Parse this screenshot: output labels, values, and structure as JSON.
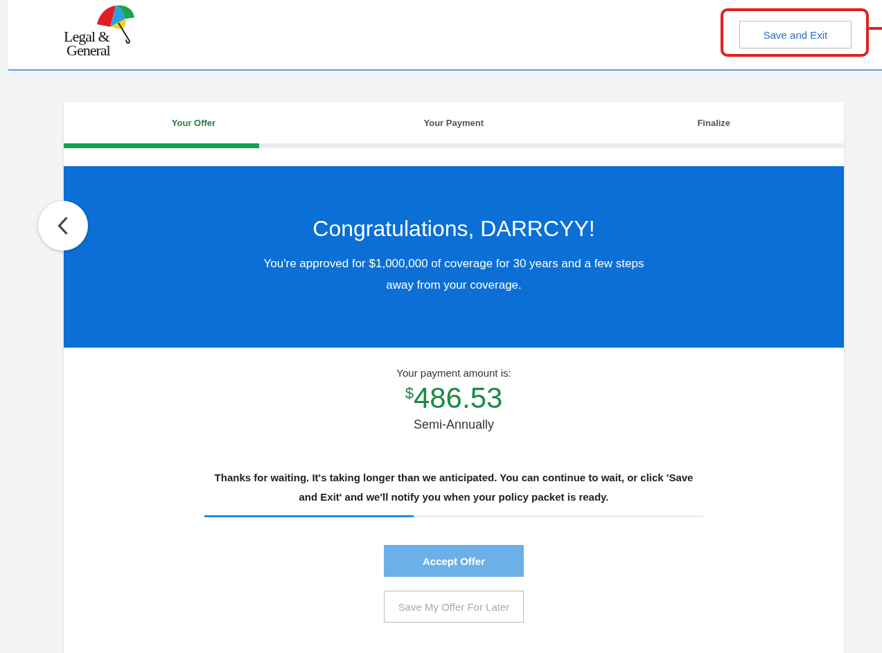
{
  "header": {
    "logo": {
      "line_1": "Legal &",
      "line_2": "General"
    },
    "save_button": {
      "label": "Save and Exit",
      "highlighted": true
    }
  },
  "steps": [
    {
      "label": "Your Offer",
      "selected": true
    },
    {
      "label": "Your Payment",
      "selected": false
    },
    {
      "label": "Finalize",
      "selected": false
    }
  ],
  "step_progress": {
    "level": 0.25
  },
  "banner": {
    "title": "Congratulations, DARRCYY!",
    "message": "You're approved for $1,000,000 of coverage for 30 years and a few steps away from your coverage."
  },
  "payment": {
    "label": "Your payment amount is:",
    "currency": "$",
    "amount": "486.53",
    "frequency": "Semi-Annually"
  },
  "notice": "Thanks for waiting. It's taking longer than we anticipated. You can continue to wait, or click 'Save and Exit' and we'll notify you when your policy packet is ready.",
  "loading": {
    "level": 0.42
  },
  "buttons": [
    {
      "label": "Accept Offer",
      "kind": "primary",
      "disabled": true
    },
    {
      "label": "Save My Offer For Later",
      "kind": "secondary",
      "disabled": true
    }
  ]
}
